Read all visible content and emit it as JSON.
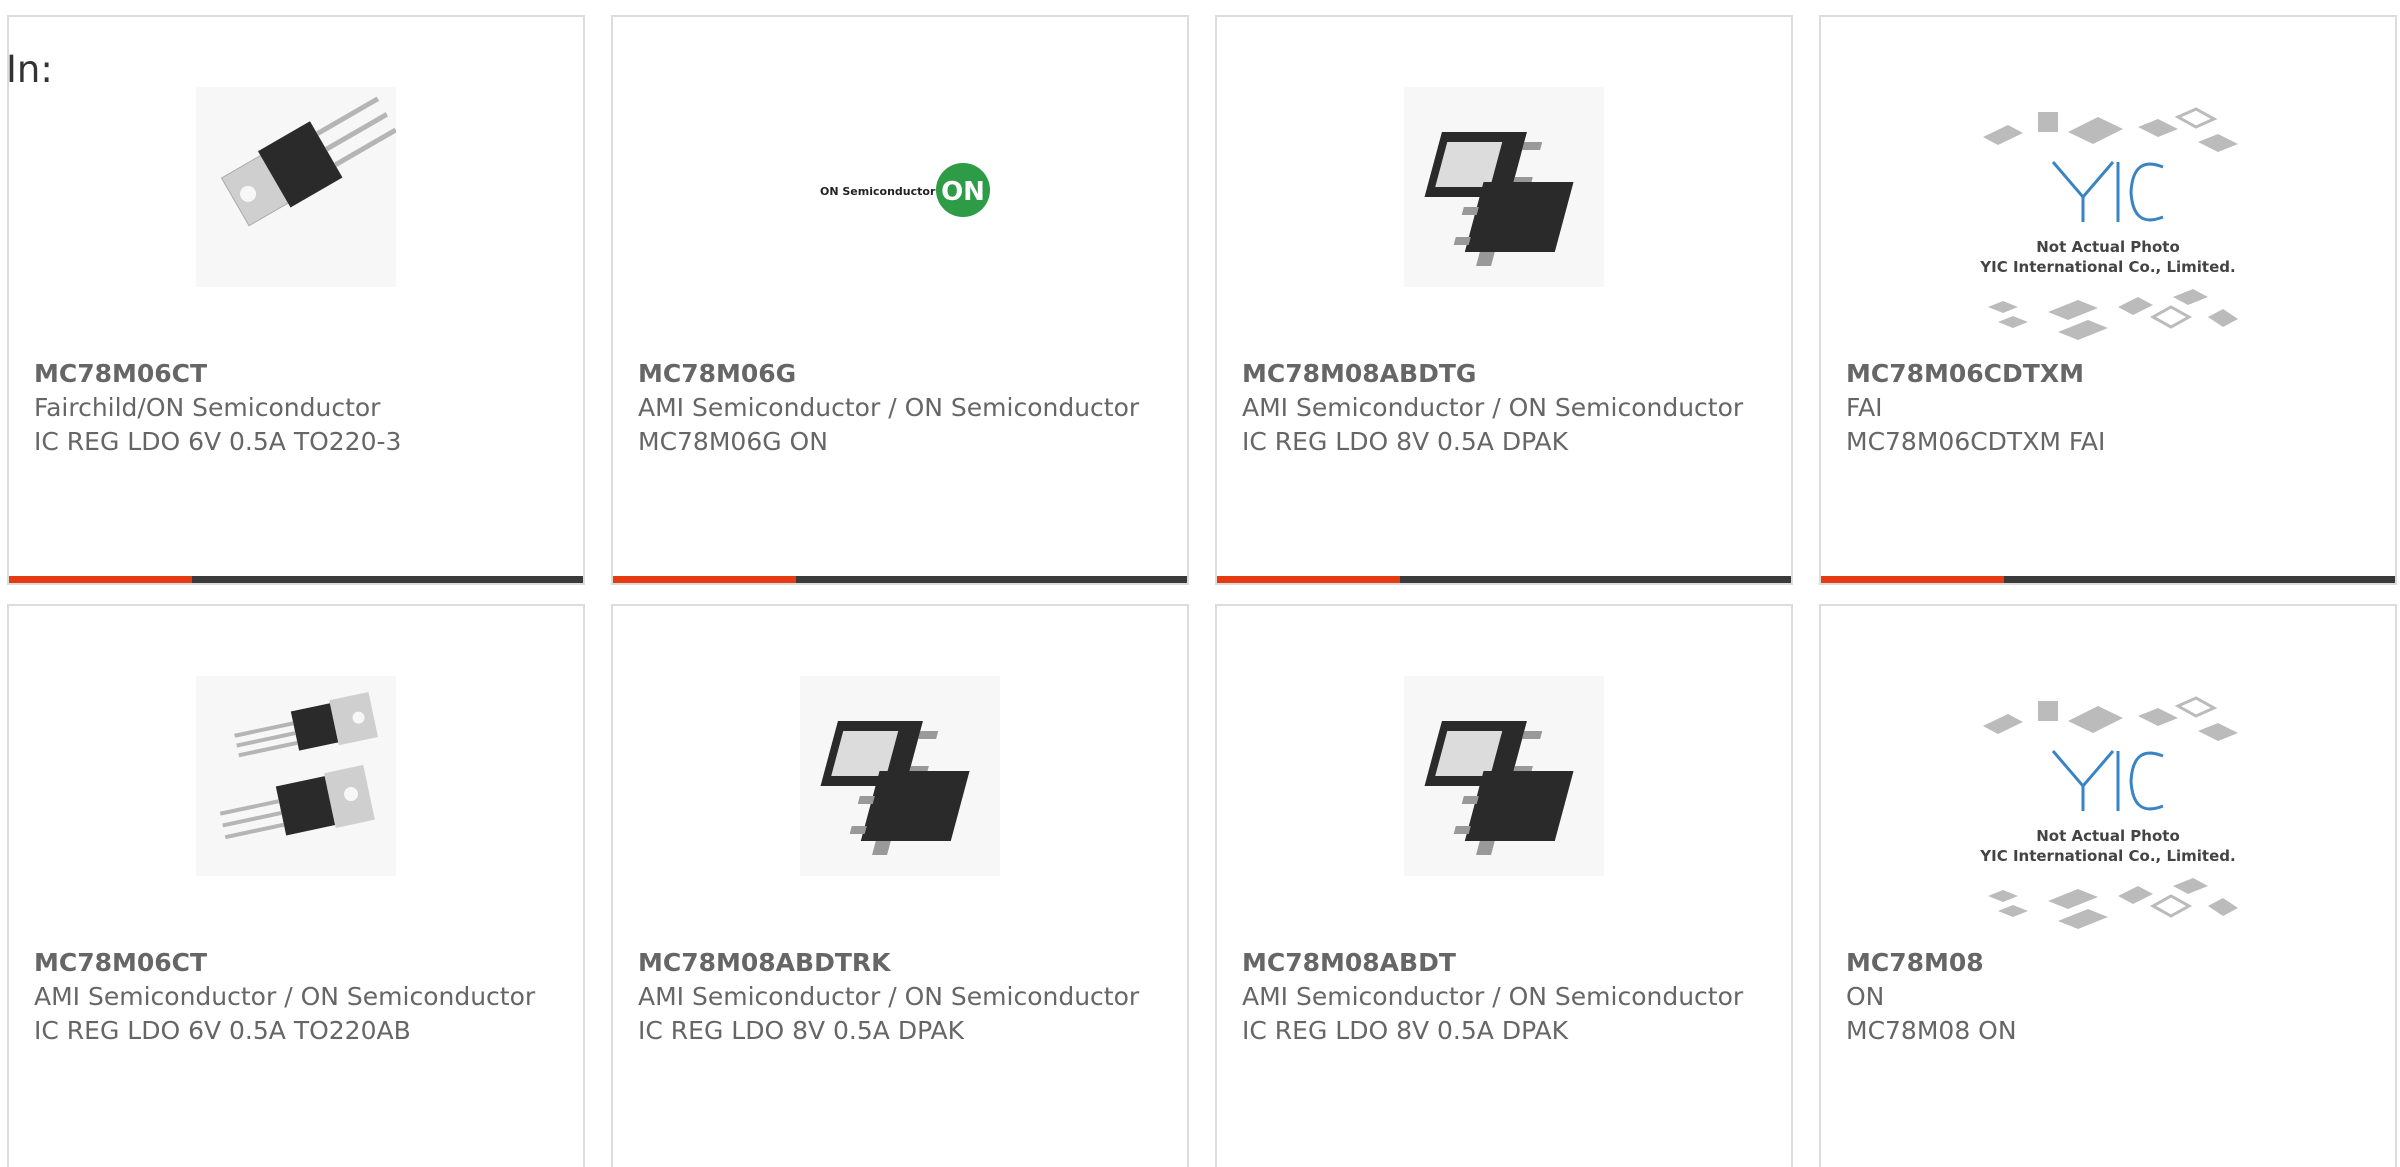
{
  "filter_label": "In:",
  "colors": {
    "accent": "#e63b12",
    "bar": "#3a3a3a",
    "text": "#666666",
    "border": "#dcdcdc"
  },
  "products": [
    {
      "part": "MC78M06CT",
      "manufacturer": "Fairchild/ON Semiconductor",
      "description": "IC REG LDO 6V 0.5A TO220-3",
      "image": "to220-single-icon"
    },
    {
      "part": "MC78M06G",
      "manufacturer": "AMI Semiconductor / ON Semiconductor",
      "description": "MC78M06G ON",
      "image": "on-semiconductor-logo"
    },
    {
      "part": "MC78M08ABDTG",
      "manufacturer": "AMI Semiconductor / ON Semiconductor",
      "description": "IC REG LDO 8V 0.5A DPAK",
      "image": "dpak-icon"
    },
    {
      "part": "MC78M06CDTXM",
      "manufacturer": "FAI",
      "description": "MC78M06CDTXM FAI",
      "image": "yic-placeholder",
      "placeholder_text": [
        "Not Actual Photo",
        "YIC International Co., Limited."
      ]
    },
    {
      "part": "MC78M06CT",
      "manufacturer": "AMI Semiconductor / ON Semiconductor",
      "description": "IC REG LDO 6V 0.5A TO220AB",
      "image": "to220-double-icon"
    },
    {
      "part": "MC78M08ABDTRK",
      "manufacturer": "AMI Semiconductor / ON Semiconductor",
      "description": "IC REG LDO 8V 0.5A DPAK",
      "image": "dpak-icon"
    },
    {
      "part": "MC78M08ABDT",
      "manufacturer": "AMI Semiconductor / ON Semiconductor",
      "description": "IC REG LDO 8V 0.5A DPAK",
      "image": "dpak-icon"
    },
    {
      "part": "MC78M08",
      "manufacturer": "ON",
      "description": "MC78M08 ON",
      "image": "yic-placeholder",
      "placeholder_text": [
        "Not Actual Photo",
        "YIC International Co., Limited."
      ]
    }
  ],
  "logo_text": {
    "brand": "ON Semiconductor",
    "mark": "ON"
  }
}
